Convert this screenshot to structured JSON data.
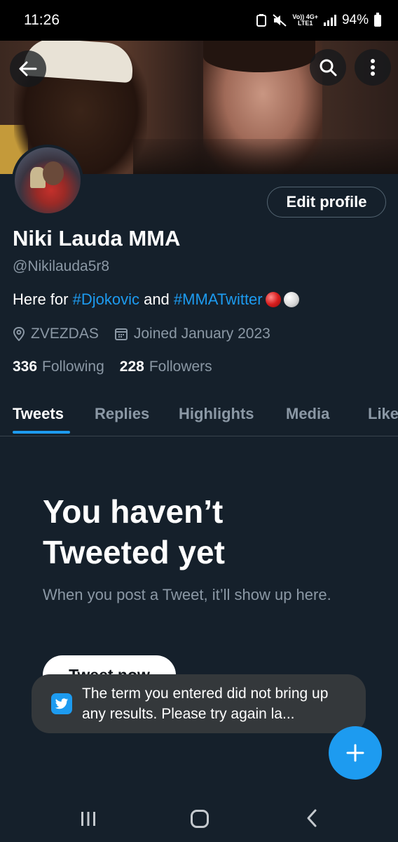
{
  "status_bar": {
    "time": "11:26",
    "network_top": "Vo)) 4G+",
    "network_bottom": "LTE1",
    "battery": "94%"
  },
  "header": {
    "back_icon": "arrow-left-icon",
    "search_icon": "search-icon",
    "more_icon": "more-vertical-icon"
  },
  "profile": {
    "edit_label": "Edit profile",
    "display_name": "Niki Lauda MMA",
    "handle": "@Nikilauda5r8",
    "bio_prefix": "Here for ",
    "bio_tag1": "#Djokovic",
    "bio_middle": " and ",
    "bio_tag2": "#MMATwitter",
    "location": "ZVEZDAS",
    "joined": "Joined January 2023",
    "following_count": "336",
    "following_label": "Following",
    "followers_count": "228",
    "followers_label": "Followers"
  },
  "tabs": [
    {
      "label": "Tweets",
      "active": true
    },
    {
      "label": "Replies",
      "active": false
    },
    {
      "label": "Highlights",
      "active": false
    },
    {
      "label": "Media",
      "active": false
    },
    {
      "label": "Likes",
      "active": false
    }
  ],
  "empty_state": {
    "title": "You haven’t Tweeted yet",
    "subtitle": "When you post a Tweet, it’ll show up here.",
    "button": "Tweet now"
  },
  "toast": {
    "message": "The term you entered did not bring up any results. Please try again la..."
  },
  "fab": {
    "icon": "plus-icon"
  },
  "colors": {
    "background": "#15202b",
    "accent": "#1d9bf0",
    "secondary_text": "#8b98a5"
  }
}
